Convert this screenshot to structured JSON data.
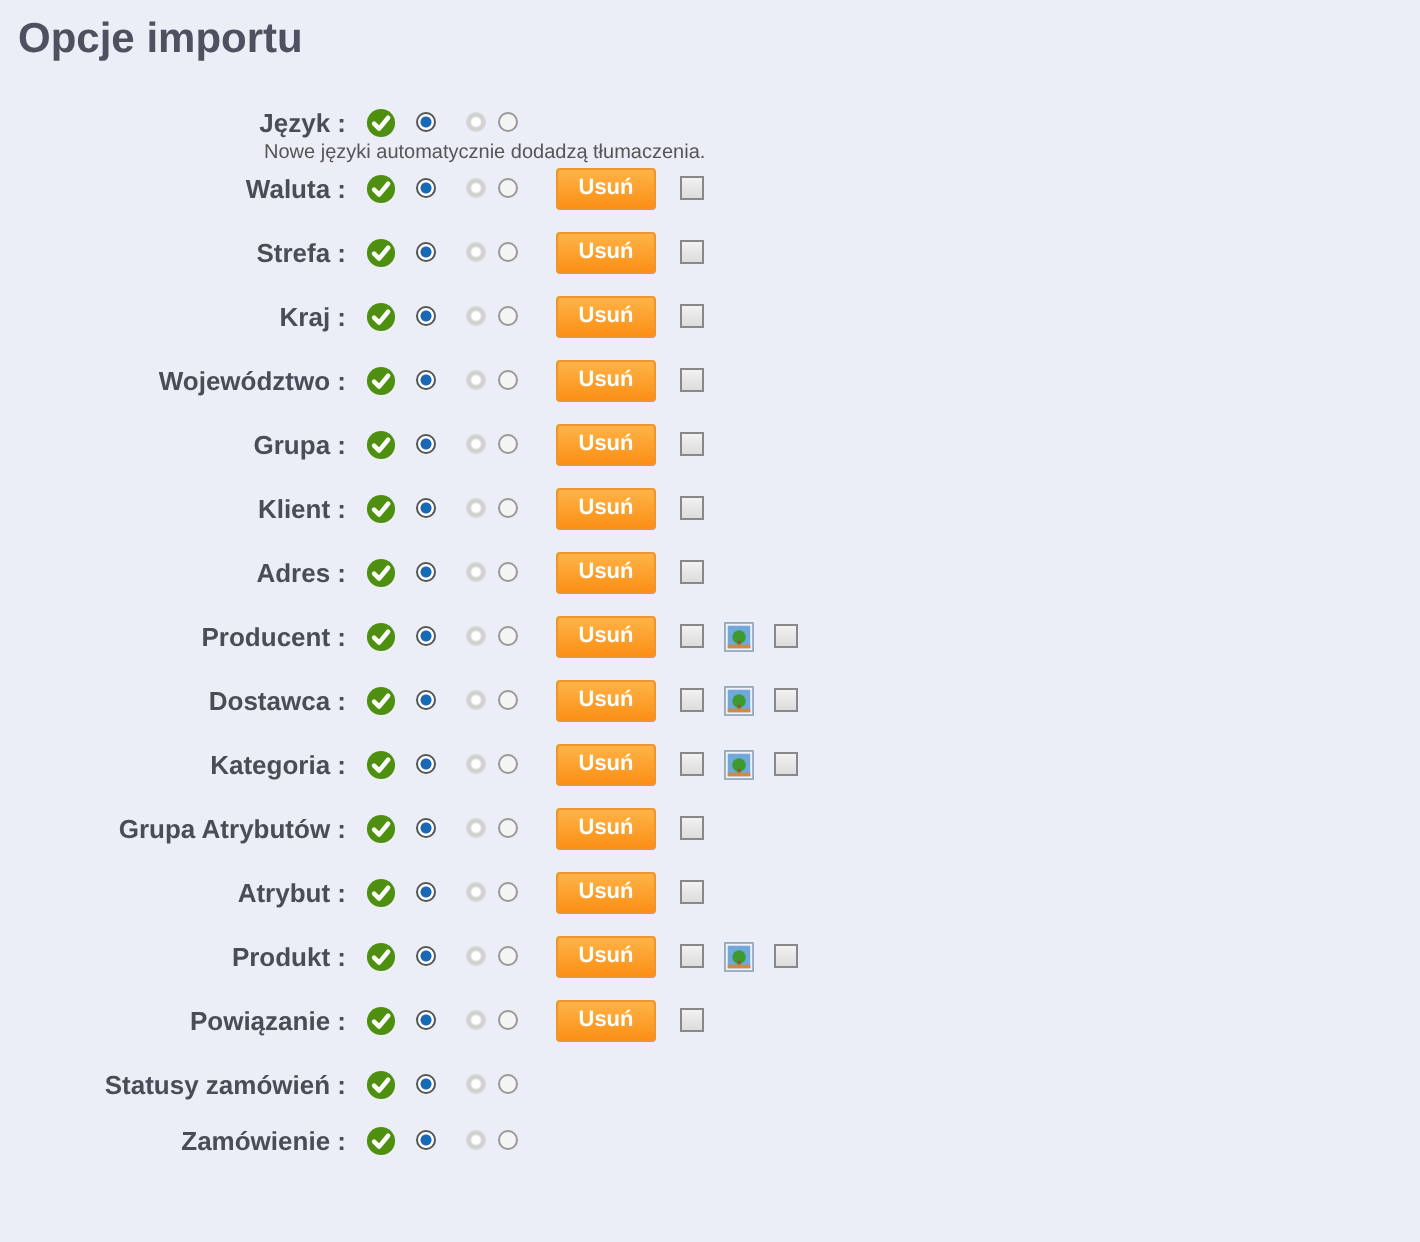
{
  "title": "Opcje importu",
  "rows": [
    {
      "label": "Język :",
      "radios": [
        {
          "selected": true,
          "disabled": false
        },
        {
          "selected": false,
          "disabled": true
        },
        {
          "selected": false,
          "disabled": false
        }
      ],
      "note": "Nowe języki automatycznie dodadzą tłumaczenia."
    },
    {
      "label": "Waluta :",
      "radios": [
        {
          "selected": true,
          "disabled": false
        },
        {
          "selected": false,
          "disabled": true
        },
        {
          "selected": false,
          "disabled": false
        }
      ],
      "button": "Usuń",
      "extras": [
        {
          "kind": "checkbox",
          "checked": false
        }
      ]
    },
    {
      "label": "Strefa :",
      "radios": [
        {
          "selected": true,
          "disabled": false
        },
        {
          "selected": false,
          "disabled": true
        },
        {
          "selected": false,
          "disabled": false
        }
      ],
      "button": "Usuń",
      "extras": [
        {
          "kind": "checkbox",
          "checked": false
        }
      ]
    },
    {
      "label": "Kraj :",
      "radios": [
        {
          "selected": true,
          "disabled": false
        },
        {
          "selected": false,
          "disabled": true
        },
        {
          "selected": false,
          "disabled": false
        }
      ],
      "button": "Usuń",
      "extras": [
        {
          "kind": "checkbox",
          "checked": false
        }
      ]
    },
    {
      "label": "Województwo :",
      "radios": [
        {
          "selected": true,
          "disabled": false
        },
        {
          "selected": false,
          "disabled": true
        },
        {
          "selected": false,
          "disabled": false
        }
      ],
      "button": "Usuń",
      "extras": [
        {
          "kind": "checkbox",
          "checked": false
        }
      ]
    },
    {
      "label": "Grupa :",
      "radios": [
        {
          "selected": true,
          "disabled": false
        },
        {
          "selected": false,
          "disabled": true
        },
        {
          "selected": false,
          "disabled": false
        }
      ],
      "button": "Usuń",
      "extras": [
        {
          "kind": "checkbox",
          "checked": false
        }
      ]
    },
    {
      "label": "Klient :",
      "radios": [
        {
          "selected": true,
          "disabled": false
        },
        {
          "selected": false,
          "disabled": true
        },
        {
          "selected": false,
          "disabled": false
        }
      ],
      "button": "Usuń",
      "extras": [
        {
          "kind": "checkbox",
          "checked": false
        }
      ]
    },
    {
      "label": "Adres :",
      "radios": [
        {
          "selected": true,
          "disabled": false
        },
        {
          "selected": false,
          "disabled": true
        },
        {
          "selected": false,
          "disabled": false
        }
      ],
      "button": "Usuń",
      "extras": [
        {
          "kind": "checkbox",
          "checked": false
        }
      ]
    },
    {
      "label": "Producent :",
      "radios": [
        {
          "selected": true,
          "disabled": false
        },
        {
          "selected": false,
          "disabled": true
        },
        {
          "selected": false,
          "disabled": false
        }
      ],
      "button": "Usuń",
      "extras": [
        {
          "kind": "checkbox",
          "checked": false
        },
        {
          "kind": "image"
        },
        {
          "kind": "checkbox",
          "checked": false
        }
      ]
    },
    {
      "label": "Dostawca :",
      "radios": [
        {
          "selected": true,
          "disabled": false
        },
        {
          "selected": false,
          "disabled": true
        },
        {
          "selected": false,
          "disabled": false
        }
      ],
      "button": "Usuń",
      "extras": [
        {
          "kind": "checkbox",
          "checked": false
        },
        {
          "kind": "image"
        },
        {
          "kind": "checkbox",
          "checked": false
        }
      ]
    },
    {
      "label": "Kategoria :",
      "radios": [
        {
          "selected": true,
          "disabled": false
        },
        {
          "selected": false,
          "disabled": true
        },
        {
          "selected": false,
          "disabled": false
        }
      ],
      "button": "Usuń",
      "extras": [
        {
          "kind": "checkbox",
          "checked": false
        },
        {
          "kind": "image"
        },
        {
          "kind": "checkbox",
          "checked": false
        }
      ]
    },
    {
      "label": "Grupa Atrybutów :",
      "radios": [
        {
          "selected": true,
          "disabled": false
        },
        {
          "selected": false,
          "disabled": true
        },
        {
          "selected": false,
          "disabled": false
        }
      ],
      "button": "Usuń",
      "extras": [
        {
          "kind": "checkbox",
          "checked": false
        }
      ]
    },
    {
      "label": "Atrybut :",
      "radios": [
        {
          "selected": true,
          "disabled": false
        },
        {
          "selected": false,
          "disabled": true
        },
        {
          "selected": false,
          "disabled": false
        }
      ],
      "button": "Usuń",
      "extras": [
        {
          "kind": "checkbox",
          "checked": false
        }
      ]
    },
    {
      "label": "Produkt :",
      "radios": [
        {
          "selected": true,
          "disabled": false
        },
        {
          "selected": false,
          "disabled": true
        },
        {
          "selected": false,
          "disabled": false
        }
      ],
      "button": "Usuń",
      "extras": [
        {
          "kind": "checkbox",
          "checked": false
        },
        {
          "kind": "image"
        },
        {
          "kind": "checkbox",
          "checked": false
        }
      ]
    },
    {
      "label": "Powiązanie :",
      "radios": [
        {
          "selected": true,
          "disabled": false
        },
        {
          "selected": false,
          "disabled": true
        },
        {
          "selected": false,
          "disabled": false
        }
      ],
      "button": "Usuń",
      "extras": [
        {
          "kind": "checkbox",
          "checked": false
        }
      ]
    },
    {
      "label": "Statusy zamówień :",
      "radios": [
        {
          "selected": true,
          "disabled": false
        },
        {
          "selected": false,
          "disabled": true
        },
        {
          "selected": false,
          "disabled": false
        }
      ]
    },
    {
      "label": "Zamówienie :",
      "radios": [
        {
          "selected": true,
          "disabled": false
        },
        {
          "selected": false,
          "disabled": true
        },
        {
          "selected": false,
          "disabled": false
        }
      ]
    }
  ]
}
